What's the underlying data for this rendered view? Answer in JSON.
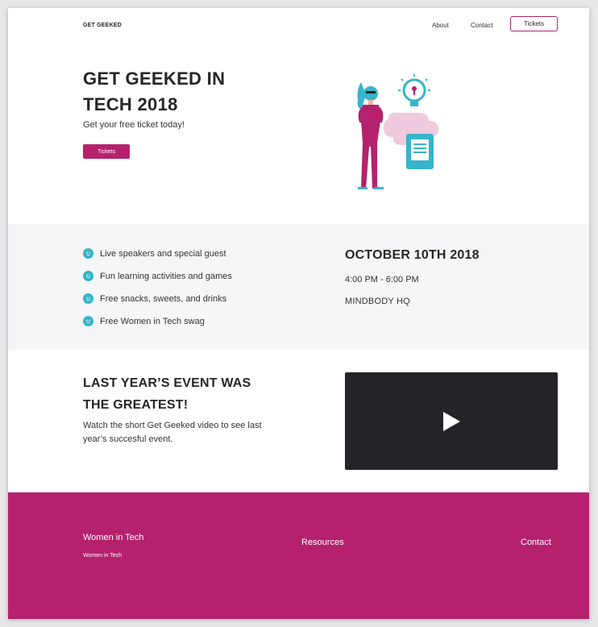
{
  "header": {
    "brand": "GET GEEKED",
    "nav": {
      "about": "About",
      "contact": "Contact",
      "tickets": "Tickets"
    }
  },
  "hero": {
    "title": "GET GEEKED IN TECH 2018",
    "subtitle": "Get your free ticket today!",
    "button": "Tickets"
  },
  "features": {
    "items": [
      "Live speakers and special guest",
      "Fun learning activities and games",
      "Free snacks, sweets, and drinks",
      "Free Women in Tech swag"
    ],
    "icon": "smiley-icon"
  },
  "event": {
    "date": "OCTOBER 10TH 2018",
    "time": "4:00 PM - 6:00 PM",
    "location": "MINDBODY HQ"
  },
  "video_section": {
    "title": "LAST YEAR’S EVENT WAS THE GREATEST!",
    "description": "Watch the short Get Geeked video to see last year’s succesful event.",
    "play_icon": "play-icon"
  },
  "footer": {
    "col1_title": "Women in Tech",
    "col1_link": "Women in Tech",
    "col2_link": "Resources",
    "col3_link": "Contact"
  },
  "colors": {
    "brand": "#b5216d",
    "accent": "#36b4c9",
    "band_bg": "#f6f6f8",
    "video_bg": "#242428"
  }
}
